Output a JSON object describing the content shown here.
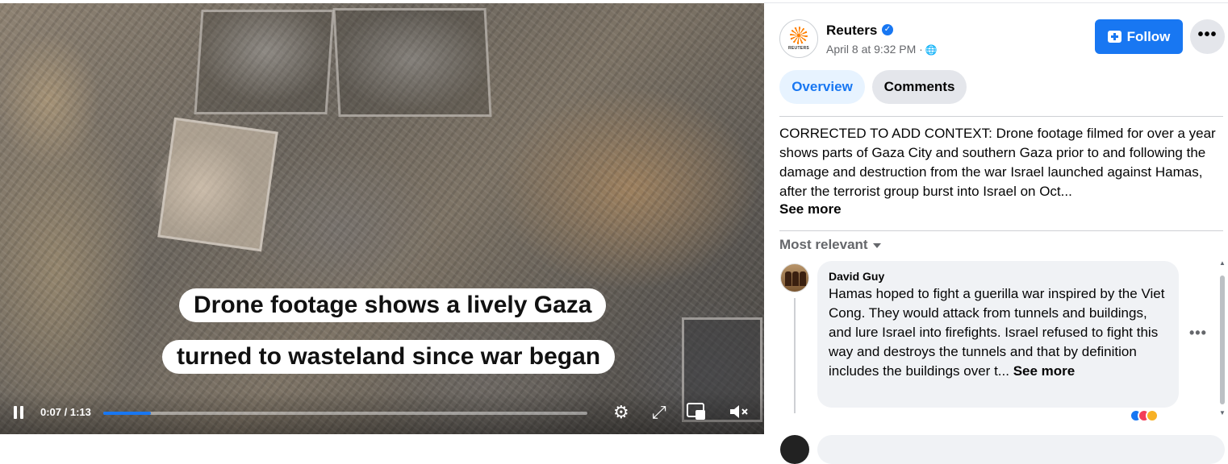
{
  "video": {
    "captions": [
      "Drone footage shows a lively Gaza",
      "turned to wasteland since war began"
    ],
    "time_display": "0:07 / 1:13",
    "progress_percent": 9.9,
    "icons": [
      "pause-icon",
      "settings-icon",
      "fullscreen-icon",
      "pip-icon",
      "mute-icon"
    ]
  },
  "post": {
    "page_name": "Reuters",
    "avatar_text": "REUTERS",
    "timestamp": "April 8 at 9:32 PM ·",
    "follow_label": "Follow",
    "more_label": "•••",
    "tabs": [
      {
        "label": "Overview",
        "active": true
      },
      {
        "label": "Comments",
        "active": false
      }
    ],
    "description": "CORRECTED TO ADD CONTEXT: Drone footage filmed for over a year shows parts of Gaza City and southern Gaza prior to and following the damage and destruction from the war Israel launched against Hamas, after the terrorist group burst into Israel on Oct...",
    "see_more": "See more"
  },
  "comments": {
    "sort_label": "Most relevant",
    "items": [
      {
        "author": "David Guy",
        "text": "Hamas hoped to fight a guerilla war inspired by the Viet Cong. They would attack from tunnels and buildings, and lure Israel into firefights. Israel refused to fight this way and destroys the tunnels and that by definition includes the buildings over t...",
        "see_more": "See more",
        "more_label": "•••"
      }
    ]
  },
  "colors": {
    "accent": "#1877f2",
    "tab_active_bg": "#e7f3ff",
    "secondary_text": "#65676b",
    "bubble_bg": "#f0f2f5"
  }
}
